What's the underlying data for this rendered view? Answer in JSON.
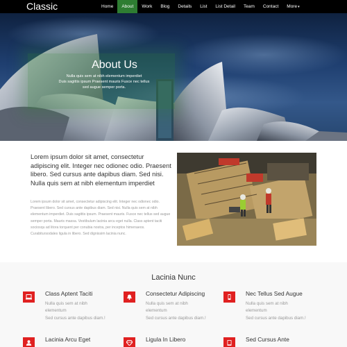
{
  "brand": "Classic",
  "nav": {
    "items": [
      {
        "label": "Home"
      },
      {
        "label": "About"
      },
      {
        "label": "Work"
      },
      {
        "label": "Blog"
      },
      {
        "label": "Details"
      },
      {
        "label": "List"
      },
      {
        "label": "List Detail"
      },
      {
        "label": "Team"
      },
      {
        "label": "Contact"
      },
      {
        "label": "More"
      }
    ],
    "active": "About"
  },
  "hero": {
    "title": "About Us",
    "lines": [
      "Nulla quis sem at nibh elementum imperdiet",
      "Duis sagittis ipsum Praesent mauris Fusce nec tellus",
      "sed augue semper porta."
    ]
  },
  "about": {
    "heading": "Lorem ipsum dolor sit amet, consectetur adipiscing elit. Integer nec odionec odio. Praesent libero. Sed cursus ante dapibus diam. Sed nisi. Nulla quis sem at nibh elementum imperdiet",
    "body": "Lorem ipsum dolor sit amet, consectetur adipiscing elit. Integer nec odionec odio. Praesent libero. Sed cursus ante dapibus diam. Sed nisi. Nulla quis sem at nibh elementum imperdiet. Duis sagittis ipsum. Praesent mauris. Fusce nec tellus sed augue semper porta. Mauris massa. Vestibulum lacinia arcu eget nulla. Class aptent taciti sociosqu ad litora torquent per conubia nostra, per inceptos himenaeos. Curabitursodales ligula in libero. Sed dignissim lacinia nunc."
  },
  "features": {
    "title": "Lacinia Nunc",
    "items": [
      {
        "title": "Class Aptent Taciti",
        "line1": "Nulla quis sem at nibh",
        "line1b": "elementum",
        "line2": "Sed cursus ante dapibus diam.!",
        "icon": "laptop-icon"
      },
      {
        "title": "Consectetur Adipiscing",
        "line1": "Nulla quis sem at nibh",
        "line1b": "elementum",
        "line2": "Sed cursus ante dapibus diam.!",
        "icon": "bell-icon"
      },
      {
        "title": "Nec Tellus Sed Augue",
        "line1": "Nulla quis sem at nibh",
        "line1b": "elementum",
        "line2": "Sed cursus ante dapibus diam.!",
        "icon": "mobile-icon"
      },
      {
        "title": "Lacinia Arcu Eget",
        "icon": "user-icon"
      },
      {
        "title": "Ligula In Libero",
        "icon": "diamond-icon"
      },
      {
        "title": "Sed Cursus Ante",
        "icon": "tablet-icon"
      }
    ]
  },
  "colors": {
    "accent": "#2e7d32",
    "icon_bg": "#e02020",
    "nav_bg": "#000000"
  }
}
